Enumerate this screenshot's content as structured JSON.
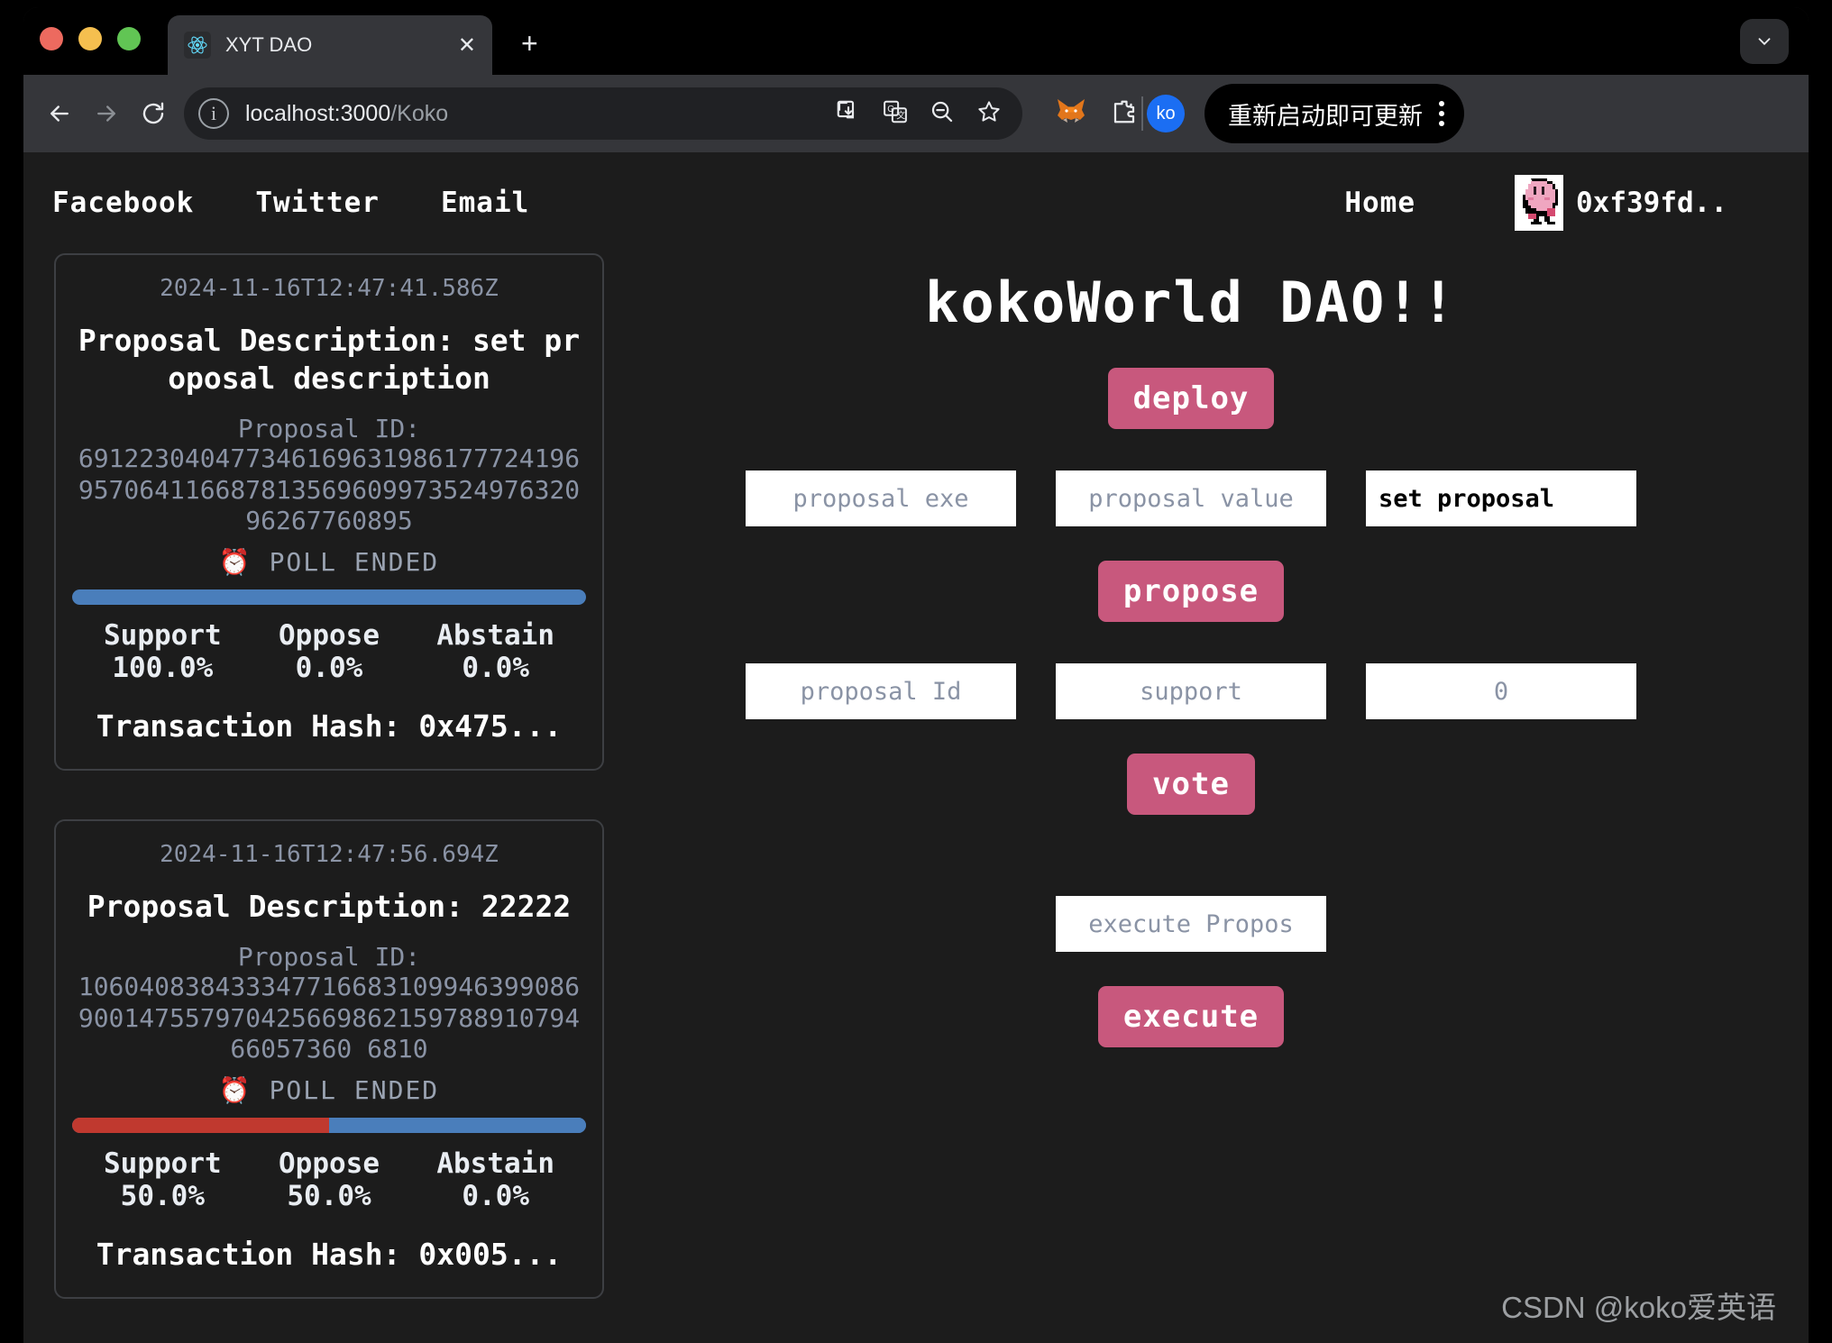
{
  "browser": {
    "tab": {
      "title": "XYT DAO",
      "favicon_icon": "react-logo-icon",
      "close_icon": "close-icon"
    },
    "new_tab_label": "+",
    "tab_list_icon": "chevron-down-icon",
    "back_icon": "back-arrow-icon",
    "forward_icon": "forward-arrow-icon",
    "reload_icon": "reload-icon",
    "omnibox": {
      "info_icon": "info-circle-icon",
      "url_host": "localhost:3000",
      "url_path": "/Koko",
      "actions": [
        "install-app-icon",
        "translate-icon",
        "zoom-out-icon",
        "bookmark-star-icon"
      ]
    },
    "extensions": [
      "metamask-fox-icon",
      "extensions-puzzle-icon"
    ],
    "profile_initials": "ko",
    "update_button_label": "重新启动即可更新",
    "menu_icon": "kebab-menu-icon"
  },
  "site_nav": {
    "links": [
      "Facebook",
      "Twitter",
      "Email"
    ],
    "home_label": "Home",
    "avatar_icon": "kirby-avatar-icon",
    "wallet_address": "0xf39fd.."
  },
  "proposals": [
    {
      "timestamp": "2024-11-16T12:47:41.586Z",
      "description_label": "Proposal Description:",
      "description": "set proposal description",
      "id_label": "Proposal ID:",
      "id": "69122304047734616963198617772419695706411668781356960997352497632096267760895",
      "status_icon": "alarm-clock-icon",
      "status": "POLL ENDED",
      "votes": {
        "support": "100.0%",
        "oppose": "0.0%",
        "abstain": "0.0%"
      },
      "vote_pct": {
        "support": 100,
        "oppose": 0,
        "abstain": 0
      },
      "tally_labels": [
        "Support",
        "Oppose",
        "Abstain"
      ],
      "tx_label": "Transaction Hash:",
      "tx_hash": "0x475..."
    },
    {
      "timestamp": "2024-11-16T12:47:56.694Z",
      "description_label": "Proposal Description:",
      "description": "22222",
      "id_label": "Proposal ID:",
      "id": "10604083843334771668310994639908690014755797042566986215978891079466057360 6810",
      "status_icon": "alarm-clock-icon",
      "status": "POLL ENDED",
      "votes": {
        "support": "50.0%",
        "oppose": "50.0%",
        "abstain": "0.0%"
      },
      "vote_pct": {
        "support": 50,
        "oppose": 50,
        "abstain": 0
      },
      "tally_labels": [
        "Support",
        "Oppose",
        "Abstain"
      ],
      "tx_label": "Transaction Hash:",
      "tx_hash": "0x005..."
    }
  ],
  "dao": {
    "title": "kokoWorld DAO!!",
    "deploy_label": "deploy",
    "propose_row": {
      "exe_placeholder": "proposal exe",
      "value_placeholder": "proposal value",
      "description_value": "set proposal ",
      "button_label": "propose"
    },
    "vote_row": {
      "id_placeholder": "proposal Id",
      "support_placeholder": "support",
      "amount_placeholder": "0",
      "button_label": "vote"
    },
    "execute_row": {
      "placeholder": "execute Propos",
      "button_label": "execute"
    }
  },
  "watermark": "CSDN @koko爱英语",
  "colors": {
    "page_bg": "#1c1c1c",
    "accent_pink": "#c8587d",
    "support_blue": "#4a7ebb",
    "oppose_red": "#c0392f",
    "muted_text": "#8a93a5"
  }
}
